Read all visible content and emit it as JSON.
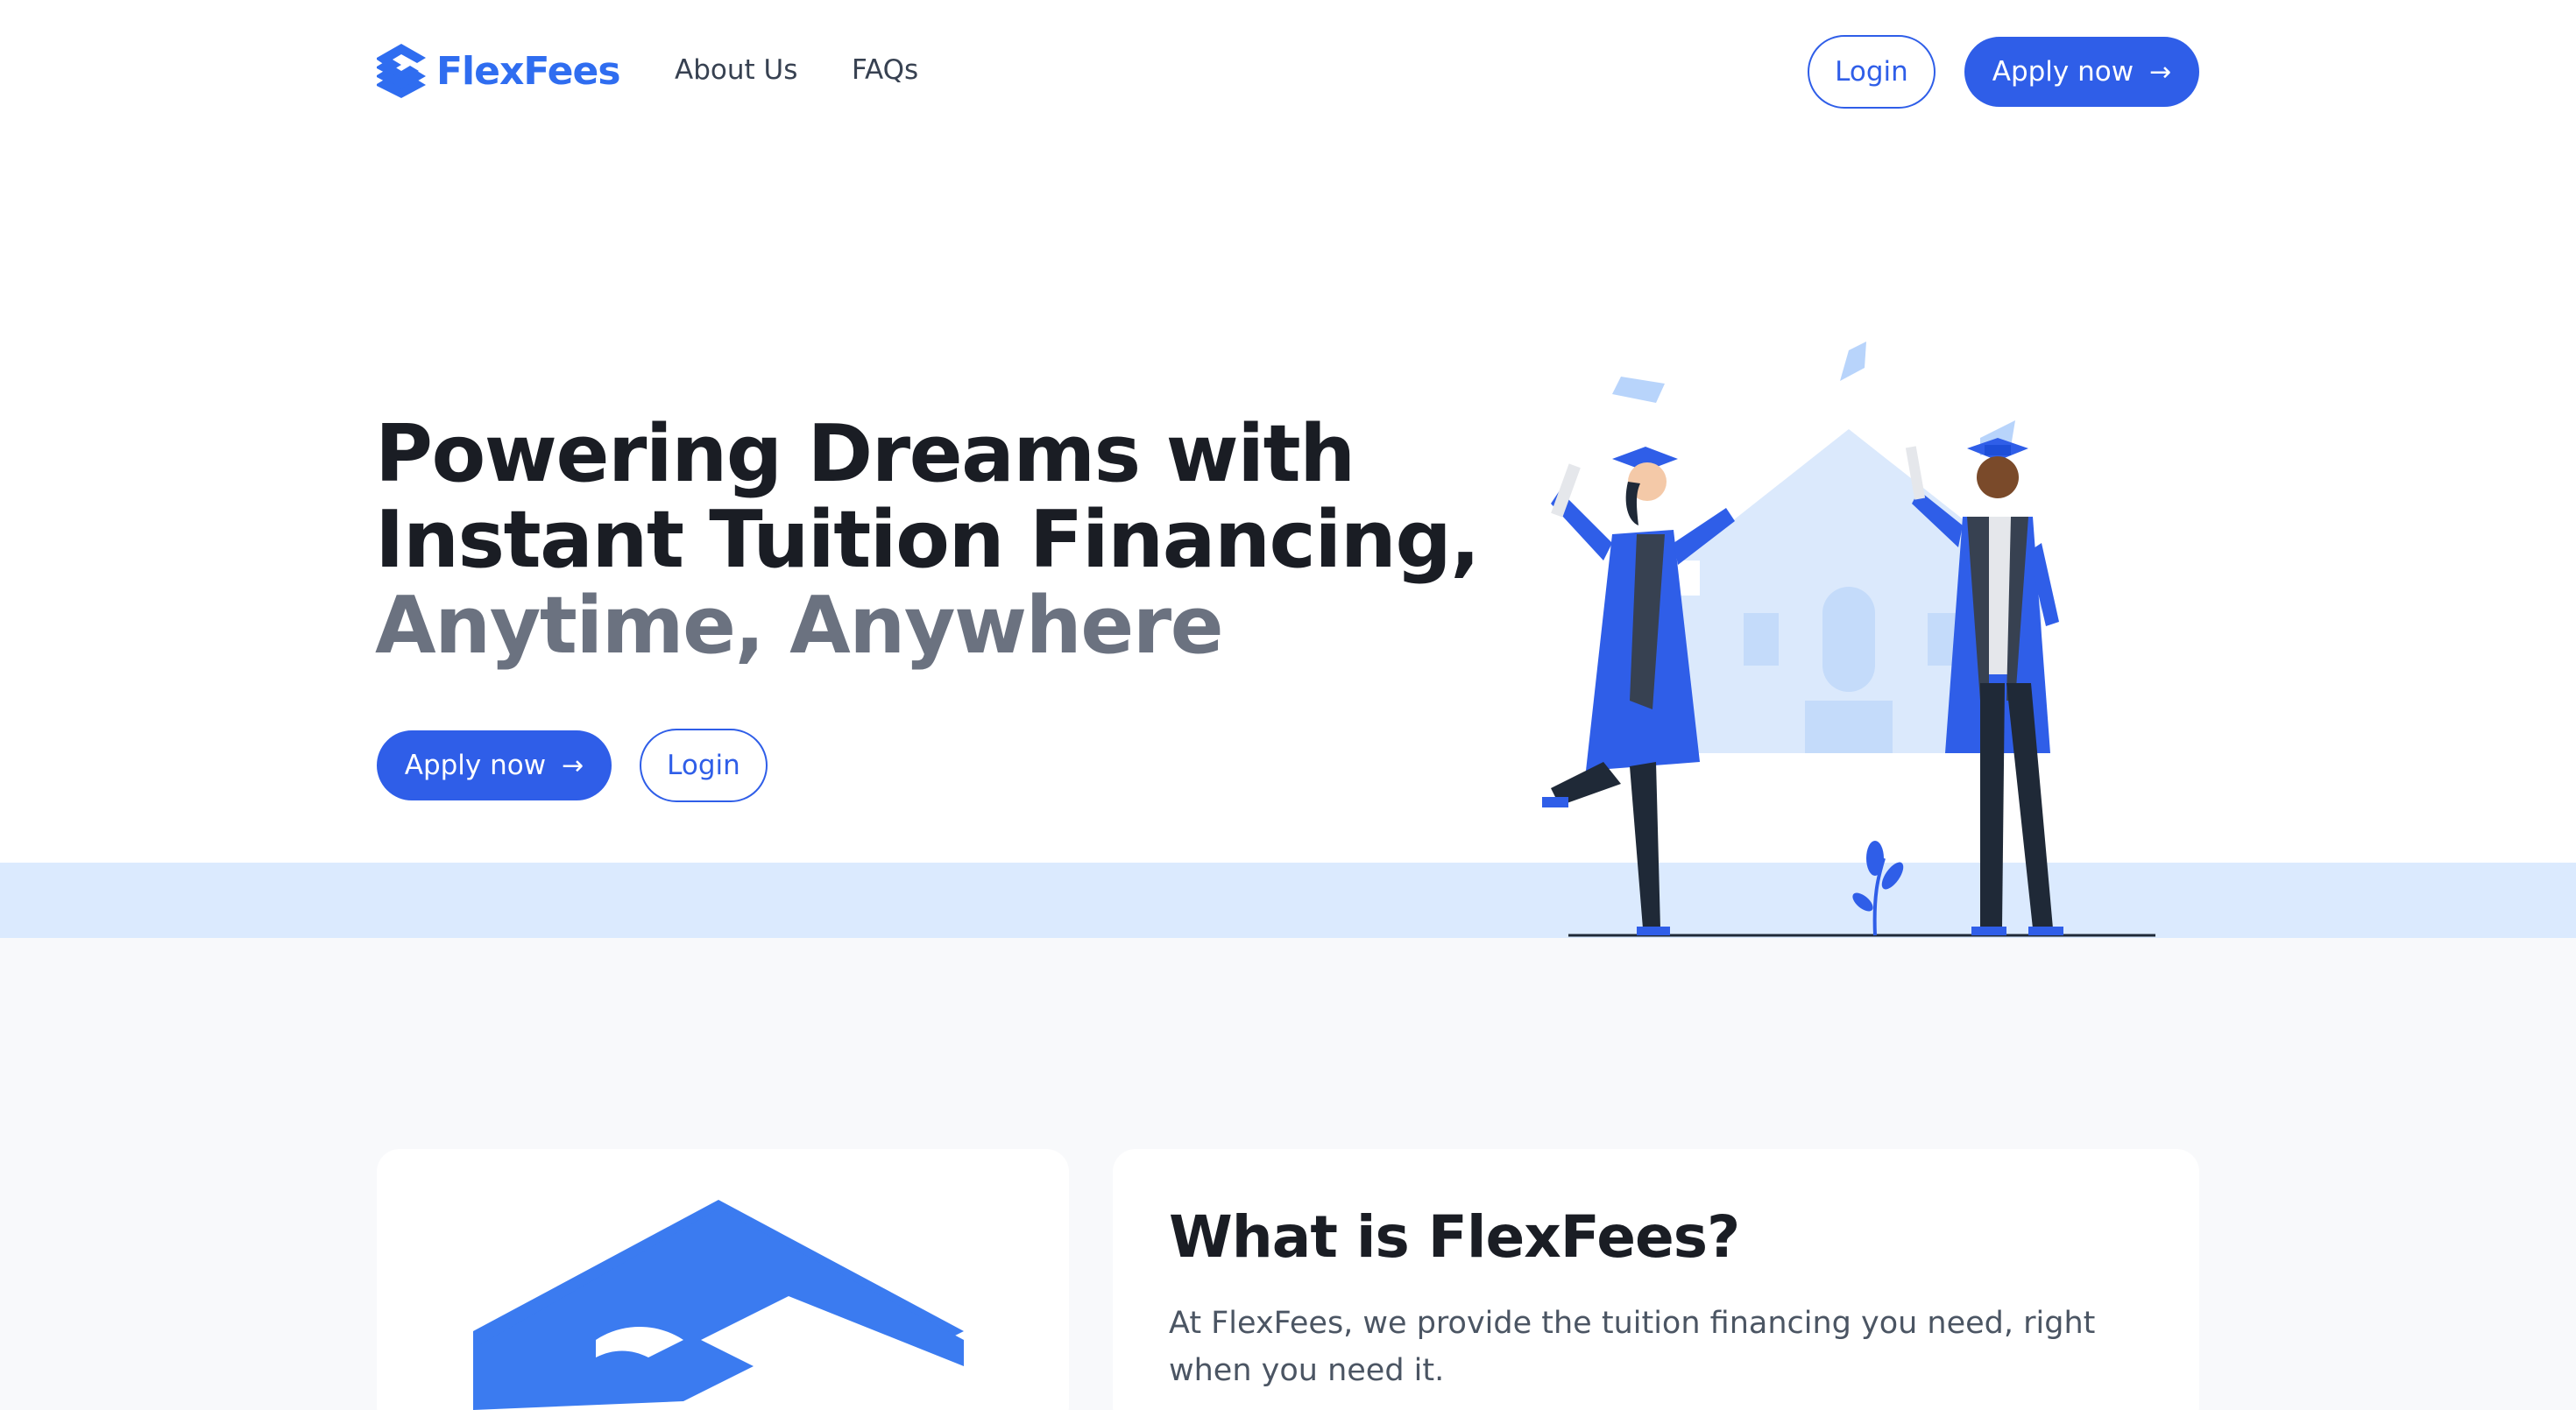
{
  "brand": {
    "name": "FlexFees",
    "accent_color": "#2f5ee8",
    "logo_color": "#2f6df0"
  },
  "nav": {
    "about": "About Us",
    "faqs": "FAQs",
    "login": "Login",
    "apply": "Apply now",
    "apply_icon": "arrow-right-icon"
  },
  "hero": {
    "title_line1": "Powering Dreams with",
    "title_line2": "Instant Tuition Financing,",
    "title_line3": "Anytime, Anywhere",
    "apply": "Apply now",
    "login": "Login",
    "illustration": "graduates-celebrating-illustration",
    "band_color": "#dbeafe"
  },
  "about": {
    "title": "What is FlexFees?",
    "text": "At FlexFees, we provide the tuition financing you need, right when you need it."
  }
}
